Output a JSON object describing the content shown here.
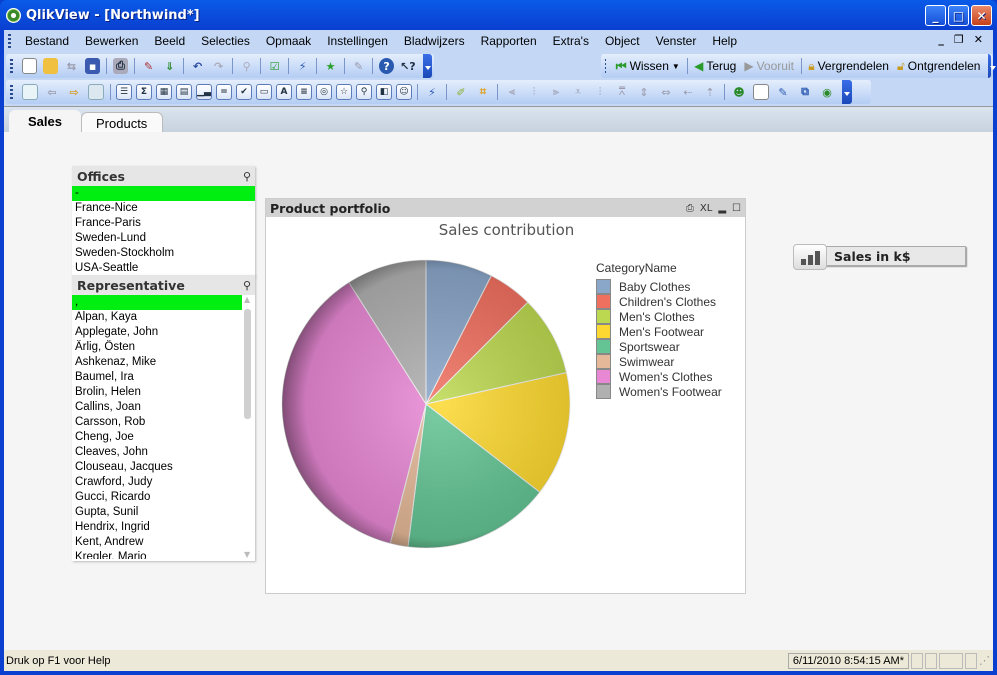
{
  "window": {
    "title": "QlikView - [Northwind*]"
  },
  "menubar": {
    "items": [
      "Bestand",
      "Bewerken",
      "Beeld",
      "Selecties",
      "Opmaak",
      "Instellingen",
      "Bladwijzers",
      "Rapporten",
      "Extra's",
      "Object",
      "Venster",
      "Help"
    ]
  },
  "toolbar_standard": {
    "icons": [
      "new-document-icon",
      "open-folder-icon",
      "reload-icon",
      "save-icon",
      "print-icon",
      "edit-script-icon",
      "reload-data-icon",
      "undo-icon",
      "redo-icon",
      "search-icon",
      "selection-check-icon",
      "chart-wizard-icon",
      "bookmark-star-icon",
      "edit-icon",
      "help-icon",
      "context-help-icon"
    ]
  },
  "toolbar_navigation": {
    "clear_label": "Wissen",
    "back_label": "Terug",
    "forward_label": "Vooruit",
    "lock_label": "Vergrendelen",
    "unlock_label": "Ontgrendelen"
  },
  "toolbar_design": {
    "icons": [
      "new-sheet-icon",
      "promote-sheet-icon",
      "demote-sheet-icon",
      "sheet-properties-icon",
      "listbox-icon",
      "statistics-box-icon",
      "table-box-icon",
      "multibox-icon",
      "chart-icon",
      "input-box-icon",
      "current-selections-icon",
      "button-icon",
      "text-object-icon",
      "line-arrow-icon",
      "slider-icon",
      "bookmark-object-icon",
      "search-object-icon",
      "container-icon",
      "custom-object-icon",
      "expressions-icon",
      "format-painter-icon",
      "snap-icon",
      "align-left-icon",
      "center-vertical-icon",
      "align-right-icon",
      "align-bottom-icon",
      "center-horizontal-icon",
      "align-top-icon",
      "space-vertical-icon",
      "space-horizontal-icon",
      "adjust-left-icon",
      "adjust-top-icon",
      "user-icon",
      "properties-icon",
      "edit-properties-icon",
      "hierarchy-icon",
      "web-document-icon"
    ]
  },
  "tabs": [
    {
      "label": "Sales",
      "active": true
    },
    {
      "label": "Products",
      "active": false
    }
  ],
  "offices": {
    "title": "Offices",
    "items": [
      "-",
      "France-Nice",
      "France-Paris",
      "Sweden-Lund",
      "Sweden-Stockholm",
      "USA-Seattle"
    ],
    "selected": [
      "-"
    ]
  },
  "representative": {
    "title": "Representative",
    "items": [
      ",",
      "Alpan, Kaya",
      "Applegate, John",
      "Ärlig, Östen",
      "Ashkenaz, Mike",
      "Baumel, Ira",
      "Brolin, Helen",
      "Callins, Joan",
      "Carsson, Rob",
      "Cheng, Joe",
      "Cleaves, John",
      "Clouseau, Jacques",
      "Crawford, Judy",
      "Gucci, Ricardo",
      "Gupta, Sunil",
      "Hendrix, Ingrid",
      "Kent, Andrew",
      "Kregler, Mario"
    ],
    "selected": [
      ","
    ]
  },
  "chart_object": {
    "caption": "Product portfolio",
    "controls": [
      "print-icon",
      "XL",
      "minimize-icon",
      "maximize-icon"
    ]
  },
  "chart_data": {
    "type": "pie",
    "title": "Sales contribution",
    "legend_title": "CategoryName",
    "legend_position": "right",
    "categories": [
      "Baby Clothes",
      "Children's Clothes",
      "Men's Clothes",
      "Men's Footwear",
      "Sportswear",
      "Swimwear",
      "Women's Clothes",
      "Women's Footwear"
    ],
    "values": [
      7.5,
      5.0,
      9.0,
      14.0,
      16.5,
      2.0,
      37.0,
      9.0
    ],
    "colors": [
      "#8aa6c8",
      "#f07060",
      "#bcd850",
      "#fcd830",
      "#64c494",
      "#e4b898",
      "#e888d4",
      "#b0b0b0"
    ]
  },
  "kpi_button": {
    "label": "Sales in k$"
  },
  "statusbar": {
    "help": "Druk op F1 voor Help",
    "timestamp": "6/11/2010 8:54:15 AM*"
  }
}
